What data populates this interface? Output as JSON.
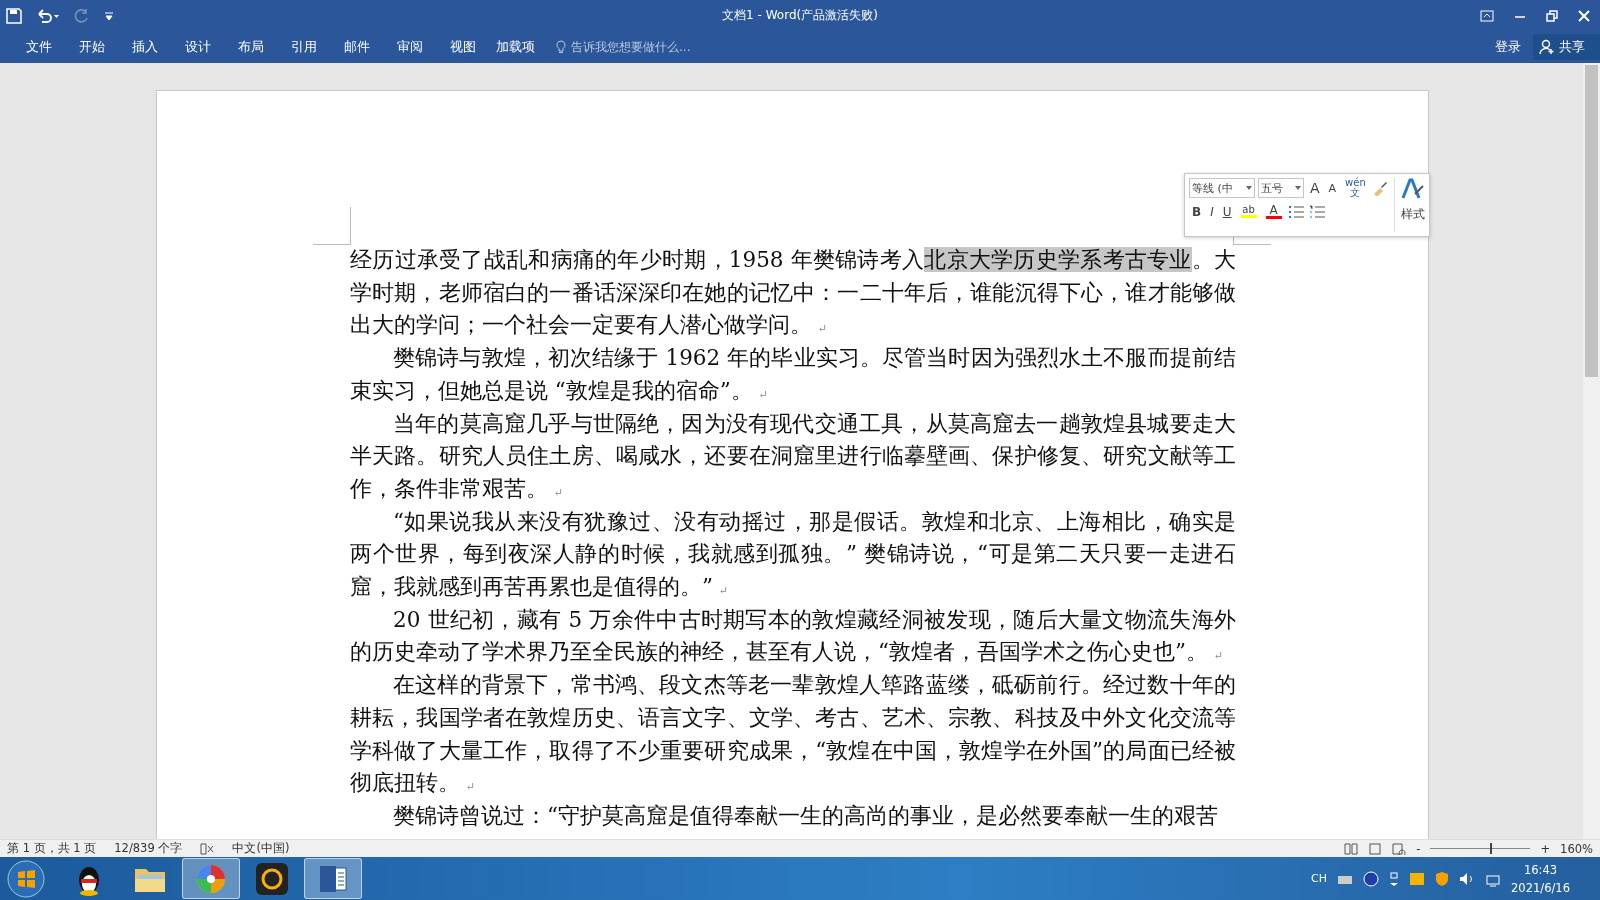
{
  "window": {
    "title": "文档1 - Word(产品激活失败)"
  },
  "quick_access": {
    "redo_disabled": true
  },
  "tabs": [
    {
      "label": "文件",
      "selected": false
    },
    {
      "label": "开始",
      "selected": false
    },
    {
      "label": "插入",
      "selected": false
    },
    {
      "label": "设计",
      "selected": false
    },
    {
      "label": "布局",
      "selected": false
    },
    {
      "label": "引用",
      "selected": false
    },
    {
      "label": "邮件",
      "selected": false
    },
    {
      "label": "审阅",
      "selected": false
    },
    {
      "label": "视图",
      "selected": false
    },
    {
      "label": "加载项",
      "selected": false
    }
  ],
  "tell_me": {
    "placeholder": "告诉我您想要做什么..."
  },
  "account": {
    "sign_in": "登录",
    "share": "共享"
  },
  "document": {
    "paragraphs": [
      {
        "indent": false,
        "before": "经历过承受了战乱和病痛的年少时期，1958 年樊锦诗考入",
        "selected": "北京大学历史学系考古专业",
        "after": "。大学时期，老师宿白的一番话深深印在她的记忆中：一二十年后，谁能沉得下心，谁才能够做出大的学问；一个社会一定要有人潜心做学问。",
        "end_mark": "↵"
      },
      {
        "indent": true,
        "before": "樊锦诗与敦煌，初次结缘于 1962 年的毕业实习。尽管当时因为强烈水土不服而提前结束实习，但她总是说 “敦煌是我的宿命”。",
        "end_mark": "↵"
      },
      {
        "indent": true,
        "before": "当年的莫高窟几乎与世隔绝，因为没有现代交通工具，从莫高窟去一趟敦煌县城要走大半天路。研究人员住土房、喝咸水，还要在洞窟里进行临摹壁画、保护修复、研究文献等工作，条件非常艰苦。",
        "end_mark": "↵"
      },
      {
        "indent": true,
        "before": " “如果说我从来没有犹豫过、没有动摇过，那是假话。敦煌和北京、上海相比，确实是两个世界，每到夜深人静的时候，我就感到孤独。” 樊锦诗说，“可是第二天只要一走进石窟，我就感到再苦再累也是值得的。”",
        "end_mark": "↵"
      },
      {
        "indent": true,
        "before": "20 世纪初，藏有 5 万余件中古时期写本的敦煌藏经洞被发现，随后大量文物流失海外的历史牵动了学术界乃至全民族的神经，甚至有人说，“敦煌者，吾国学术之伤心史也”。",
        "end_mark": "↵"
      },
      {
        "indent": true,
        "before": "在这样的背景下，常书鸿、段文杰等老一辈敦煌人筚路蓝缕，砥砺前行。经过数十年的耕耘，我国学者在敦煌历史、语言文字、文学、考古、艺术、宗教、科技及中外文化交流等学科做了大量工作，取得了不少重要研究成果，“敦煌在中国，敦煌学在外国”的局面已经被彻底扭转。",
        "end_mark": "↵"
      },
      {
        "indent": true,
        "before": "樊锦诗曾说过：“守护莫高窟是值得奉献一生的高尚的事业，是必然要奉献一生的艰苦"
      }
    ]
  },
  "mini_toolbar": {
    "font": "等线 (中",
    "size": "五号",
    "grow": "A",
    "shrink": "A",
    "phonetic_top": "wén",
    "phonetic_bottom": "文",
    "bold": "B",
    "italic": "I",
    "underline": "U",
    "highlight": "ab",
    "font_color": "A",
    "styles": "样式"
  },
  "status_bar": {
    "page": "第 1 页，共 1 页",
    "words": "12/839 个字",
    "language": "中文(中国)",
    "zoom_minus": "-",
    "zoom_plus": "+",
    "zoom_slider": {
      "level": 0.6
    },
    "zoom": "160%"
  },
  "taskbar": {
    "apps": [
      {
        "kind": "qq",
        "selected": false
      },
      {
        "kind": "folder",
        "selected": false
      },
      {
        "kind": "pinwheel",
        "selected": true
      },
      {
        "kind": "g",
        "selected": false
      },
      {
        "kind": "word",
        "selected": true
      }
    ],
    "ime": "CH",
    "time": "16:43",
    "date": "2021/6/16"
  }
}
